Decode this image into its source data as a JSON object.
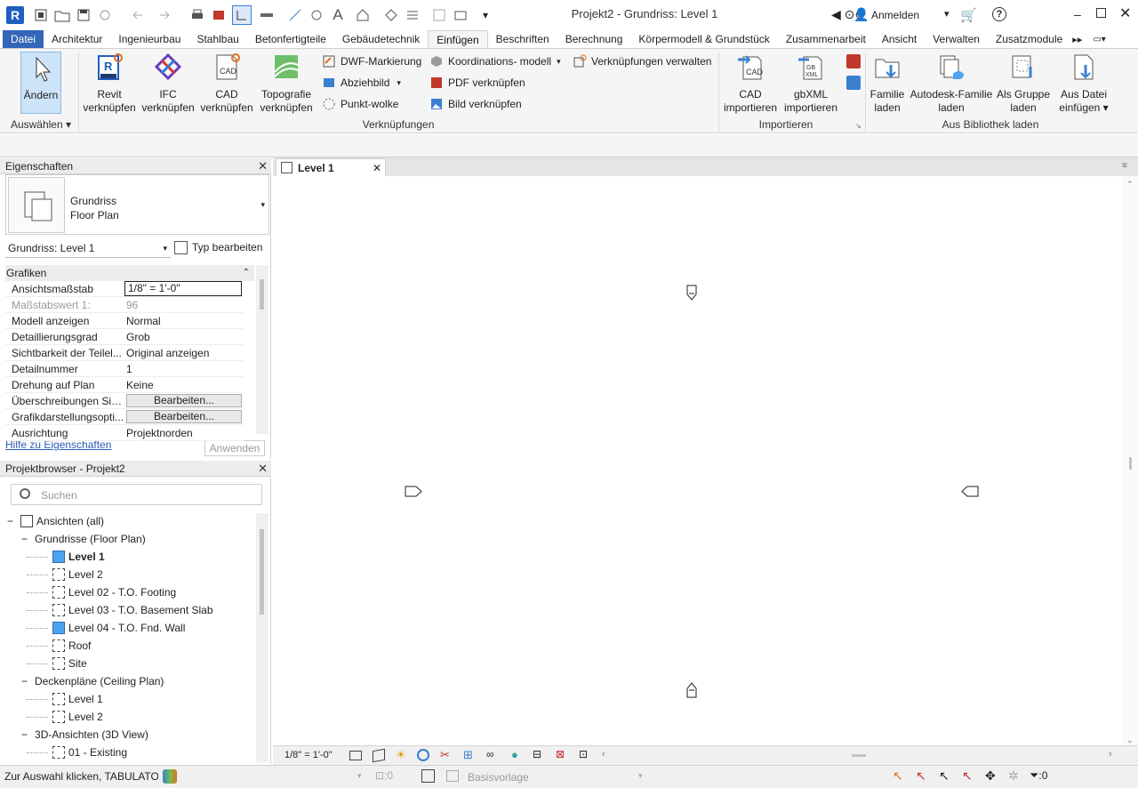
{
  "app": {
    "window_title": "Projekt2 - Grundriss: Level 1",
    "login": "Anmelden",
    "logo": "R"
  },
  "menu": {
    "tabs": [
      "Datei",
      "Architektur",
      "Ingenieurbau",
      "Stahlbau",
      "Betonfertigteile",
      "Gebäudetechnik",
      "Einfügen",
      "Beschriften",
      "Berechnung",
      "Körpermodell & Grundstück",
      "Zusammenarbeit",
      "Ansicht",
      "Verwalten",
      "Zusatzmodule"
    ],
    "active": "Einfügen"
  },
  "ribbon": {
    "select": {
      "label": "Ändern",
      "group": "Auswählen"
    },
    "links": {
      "group": "Verknüpfungen",
      "revit": "Revit\nverknüpfen",
      "revit_l1": "Revit",
      "revit_l2": "verknüpfen",
      "ifc_l1": "IFC",
      "ifc_l2": "verknüpfen",
      "cad_l1": "CAD",
      "cad_l2": "verknüpfen",
      "topo_l1": "Topografie",
      "topo_l2": "verknüpfen",
      "dwf": "DWF-Markierung",
      "decal": "Abziehbild",
      "pointcloud": "Punkt-wolke",
      "coord": "Koordinations- modell",
      "pdf": "PDF  verknüpfen",
      "image": "Bild  verknüpfen",
      "manage": "Verknüpfungen verwalten"
    },
    "import": {
      "group": "Importieren",
      "cad_l1": "CAD",
      "cad_l2": "importieren",
      "gbxml_l1": "gbXML",
      "gbxml_l2": "importieren"
    },
    "library": {
      "group": "Aus Bibliothek laden",
      "family_l1": "Familie",
      "family_l2": "laden",
      "adsk_l1": "Autodesk-Familie",
      "adsk_l2": "laden",
      "group_l1": "Als Gruppe",
      "group_l2": "laden",
      "file_l1": "Aus Datei",
      "file_l2": "einfügen"
    }
  },
  "properties": {
    "title": "Eigenschaften",
    "type_l1": "Grundriss",
    "type_l2": "Floor Plan",
    "selector": "Grundriss: Level 1",
    "edit_type": "Typ bearbeiten",
    "section": "Grafiken",
    "rows": [
      {
        "k": "Ansichtsmaßstab",
        "v": "1/8\" = 1'-0\""
      },
      {
        "k": "Maßstabswert 1:",
        "v": "96"
      },
      {
        "k": "Modell anzeigen",
        "v": "Normal"
      },
      {
        "k": "Detaillierungsgrad",
        "v": "Grob"
      },
      {
        "k": "Sichtbarkeit der Teilel...",
        "v": "Original anzeigen"
      },
      {
        "k": "Detailnummer",
        "v": "1"
      },
      {
        "k": "Drehung auf Plan",
        "v": "Keine"
      },
      {
        "k": "Überschreibungen Sic...",
        "v": "Bearbeiten..."
      },
      {
        "k": "Grafikdarstellungsopti...",
        "v": "Bearbeiten..."
      },
      {
        "k": "Ausrichtung",
        "v": "Projektnorden"
      }
    ],
    "help": "Hilfe zu Eigenschaften",
    "apply": "Anwenden"
  },
  "browser": {
    "title": "Projektbrowser - Projekt2",
    "search_placeholder": "Suchen",
    "root": "Ansichten (all)",
    "g1": "Grundrisse (Floor Plan)",
    "g1_items": [
      "Level 1",
      "Level 2",
      "Level 02 - T.O. Footing",
      "Level 03 - T.O. Basement Slab",
      "Level 04 - T.O. Fnd. Wall",
      "Roof",
      "Site"
    ],
    "g2": "Deckenpläne (Ceiling Plan)",
    "g2_items": [
      "Level 1",
      "Level 2"
    ],
    "g3": "3D-Ansichten (3D View)",
    "g3_items": [
      "01 - Existing"
    ]
  },
  "view": {
    "tab": "Level 1",
    "scale": "1/8\" = 1'-0\""
  },
  "status": {
    "message": "Zur Auswahl klicken, TABULATOR",
    "zero": ":0",
    "template": "Basisvorlage",
    "filter": ":0"
  }
}
